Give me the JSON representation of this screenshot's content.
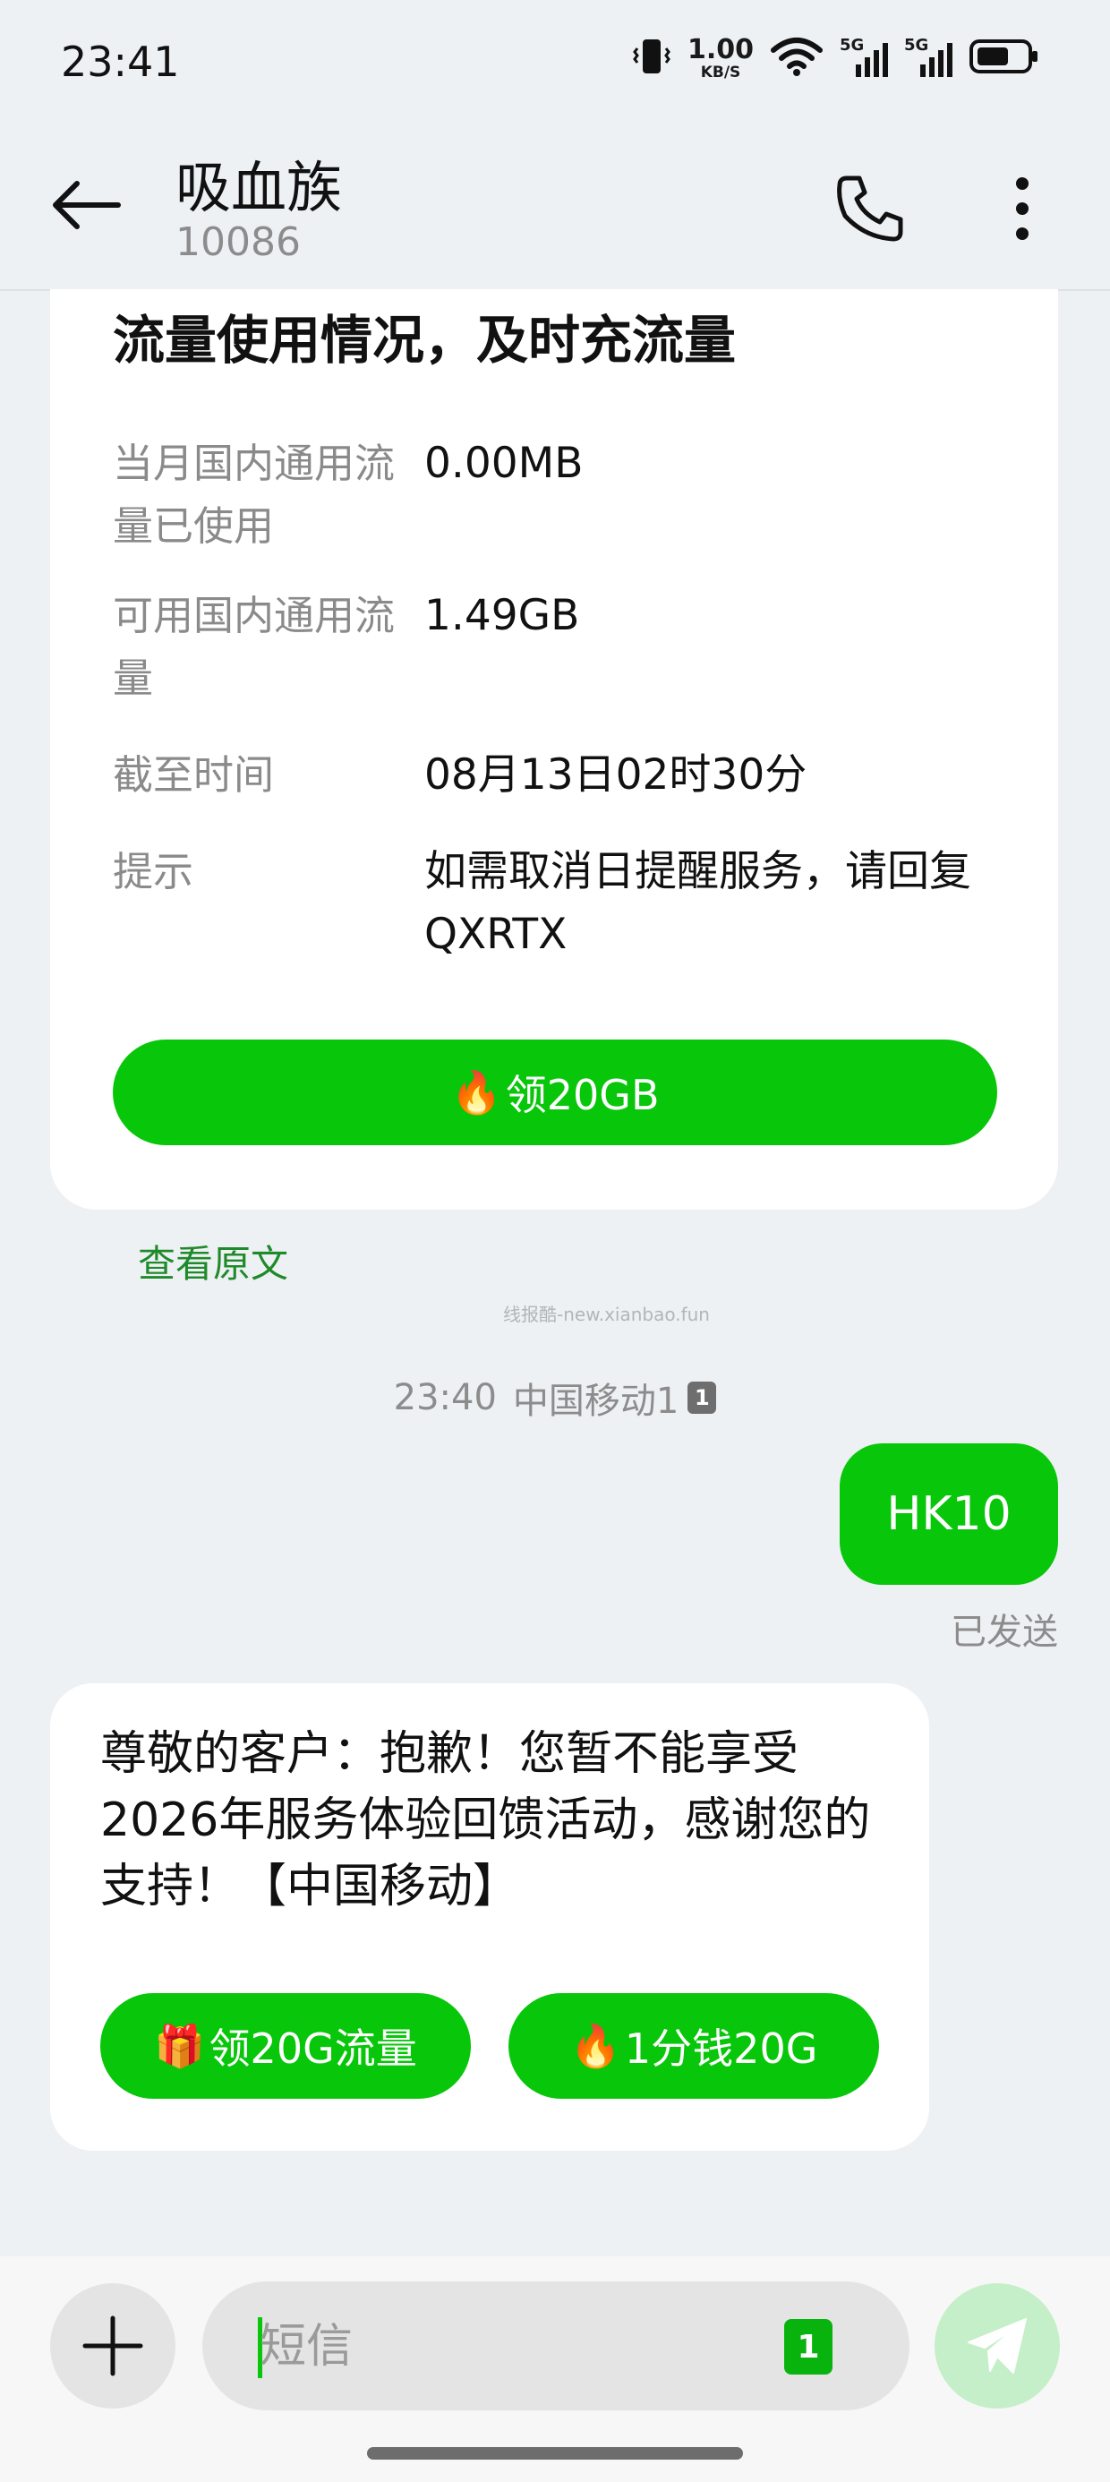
{
  "status_bar": {
    "time": "23:41",
    "speed_value": "1.00",
    "speed_unit": "KB/S",
    "network_1": "5G",
    "network_2": "5G",
    "icons": [
      "vibrate-icon",
      "wifi-icon",
      "signal-icon",
      "battery-icon"
    ]
  },
  "header": {
    "contact_name": "吸血族",
    "contact_number": "10086",
    "icons": [
      "back-arrow-icon",
      "phone-icon",
      "more-vert-icon"
    ]
  },
  "card1": {
    "title": "流量使用情况，及时充流量",
    "rows": [
      {
        "label": "当月国内通用流量已使用",
        "value": "0.00MB"
      },
      {
        "label": "可用国内通用流量",
        "value": "1.49GB"
      },
      {
        "label": "截至时间",
        "value": "08月13日02时30分"
      },
      {
        "label": "提示",
        "value": "如需取消日提醒服务，请回复QXRTX"
      }
    ],
    "button_emoji": "🔥",
    "button_label": "领20GB"
  },
  "view_original": "查看原文",
  "watermark": "线报酷-new.xianbao.fun",
  "timestamp": {
    "time": "23:40",
    "carrier": "中国移动1",
    "sim": "1"
  },
  "sent_message": {
    "text": "HK10",
    "status": "已发送"
  },
  "card2": {
    "text": "尊敬的客户：抱歉！您暂不能享受2026年服务体验回馈活动，感谢您的支持！【中国移动】",
    "button1_emoji": "🎁",
    "button1_label": "领20G流量",
    "button2_emoji": "🔥",
    "button2_label": "1分钱20G"
  },
  "input_bar": {
    "placeholder": "短信",
    "sim": "1",
    "icons": [
      "plus-icon",
      "send-icon"
    ]
  },
  "colors": {
    "accent_green": "#08c60a",
    "link_green": "#1f8a2a",
    "send_disabled": "#c5efc8",
    "background": "#eef1f4"
  }
}
